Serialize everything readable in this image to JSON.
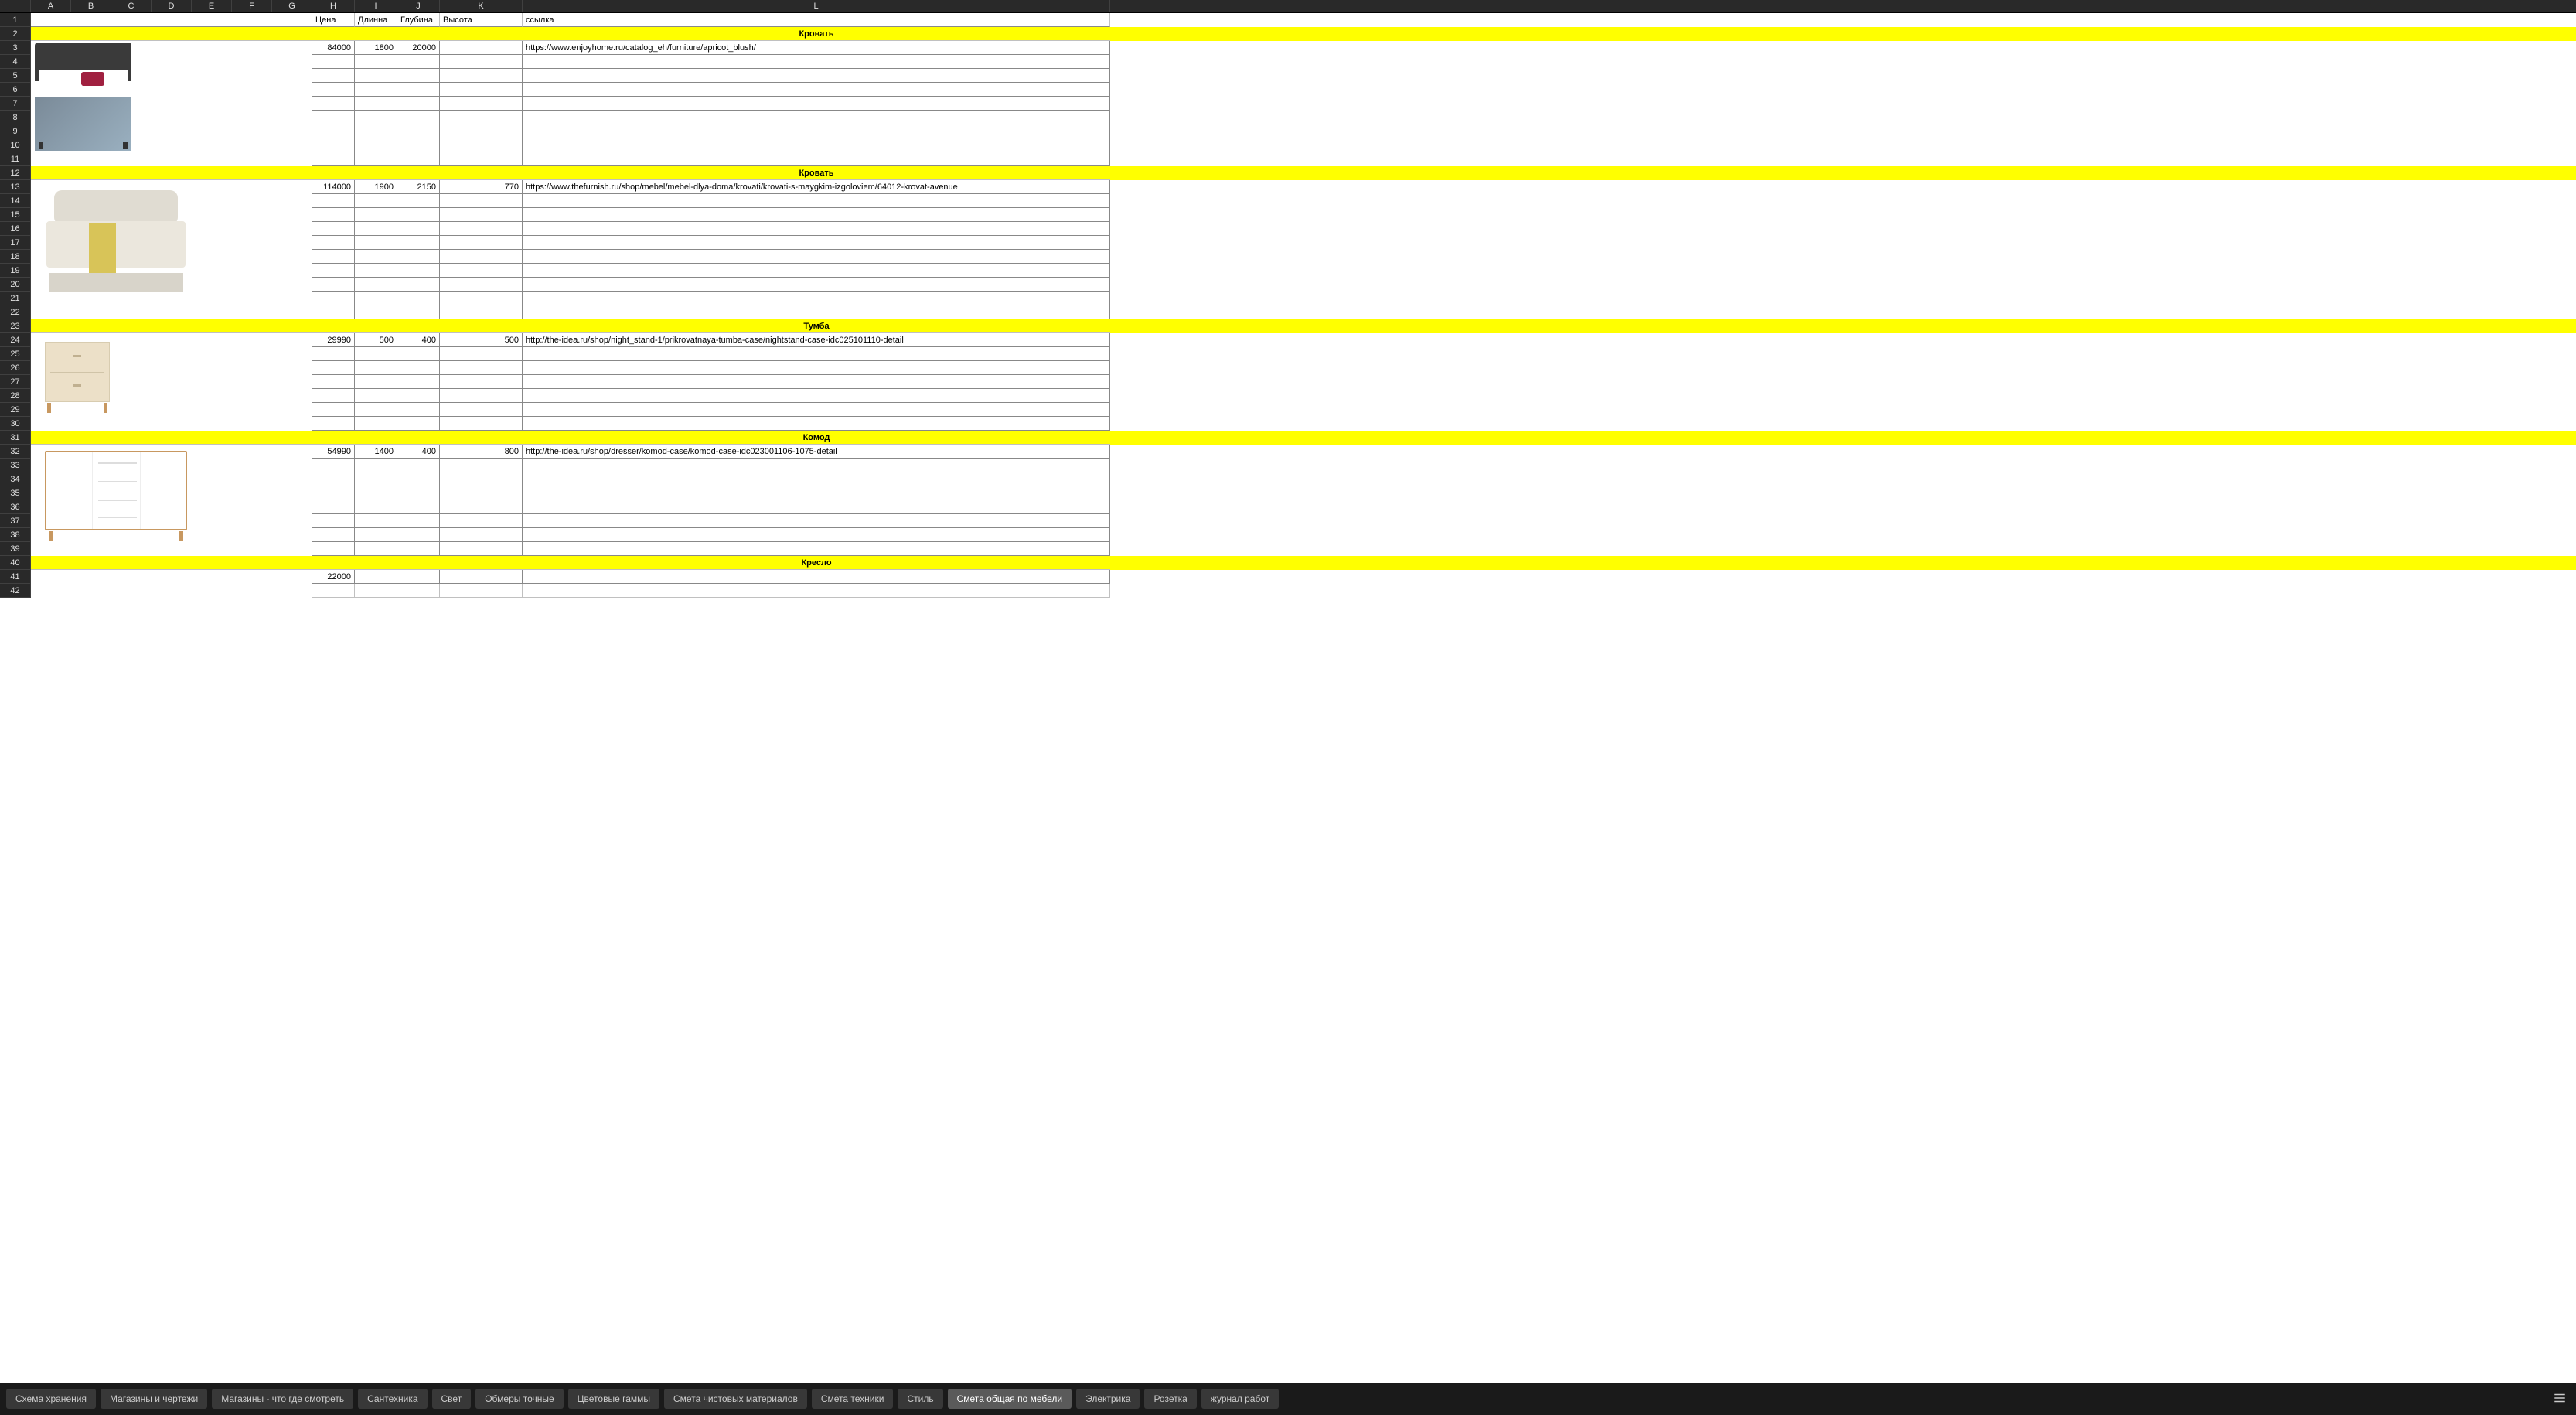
{
  "columns": [
    "A",
    "B",
    "C",
    "D",
    "E",
    "F",
    "G",
    "H",
    "I",
    "J",
    "K",
    "L"
  ],
  "headers": {
    "H": "Цена",
    "I": "Длинна",
    "J": "Глубина",
    "K": "Высота",
    "L": "ссылка"
  },
  "sections": [
    {
      "row": 2,
      "label": "Кровать"
    },
    {
      "row": 12,
      "label": "Кровать"
    },
    {
      "row": 23,
      "label": "Тумба"
    },
    {
      "row": 31,
      "label": "Комод"
    },
    {
      "row": 40,
      "label": "Кресло"
    }
  ],
  "dataRows": {
    "3": {
      "H": "84000",
      "I": "1800",
      "J": "20000",
      "K": "",
      "L": "https://www.enjoyhome.ru/catalog_eh/furniture/apricot_blush/"
    },
    "13": {
      "H": "114000",
      "I": "1900",
      "J": "2150",
      "K": "770",
      "L": "https://www.thefurnish.ru/shop/mebel/mebel-dlya-doma/krovati/krovati-s-maygkim-izgoloviem/64012-krovat-avenue"
    },
    "24": {
      "H": "29990",
      "I": "500",
      "J": "400",
      "K": "500",
      "L": "http://the-idea.ru/shop/night_stand-1/prikrovatnaya-tumba-case/nightstand-case-idc025101110-detail"
    },
    "32": {
      "H": "54990",
      "I": "1400",
      "J": "400",
      "K": "800",
      "L": "http://the-idea.ru/shop/dresser/komod-case/komod-case-idc023001106-1075-detail"
    },
    "41": {
      "H": "22000",
      "I": "",
      "J": "",
      "K": "",
      "L": ""
    }
  },
  "rowCount": 42,
  "tabs": [
    "Схема хранения",
    "Магазины и чертежи",
    "Магазины - что где смотреть",
    "Сантехника",
    "Свет",
    "Обмеры точные",
    "Цветовые гаммы",
    "Смета чистовых материалов",
    "Смета техники",
    "Стиль",
    "Смета общая по мебели",
    "Электрика",
    "Розетка",
    "журнал работ"
  ],
  "activeTab": "Смета общая по мебели",
  "blockBorders": {
    "imageless": [
      3,
      4,
      5,
      6,
      7,
      8,
      9,
      10,
      11,
      13,
      14,
      15,
      16,
      17,
      18,
      19,
      20,
      21,
      22,
      24,
      25,
      26,
      27,
      28,
      29,
      30,
      32,
      33,
      34,
      35,
      36,
      37,
      38,
      39,
      41
    ]
  }
}
